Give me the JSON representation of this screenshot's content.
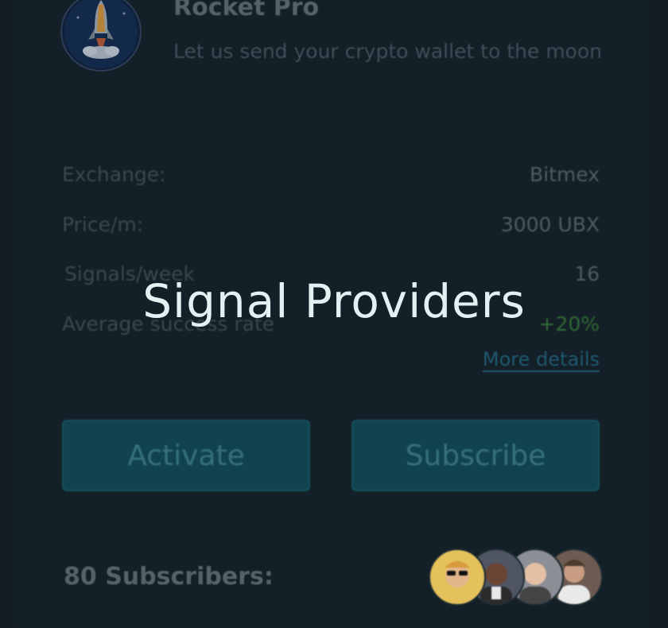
{
  "overlay": {
    "title": "Signal Providers"
  },
  "provider": {
    "name": "Rocket Pro",
    "tagline": "Let us send your crypto wallet to the moon",
    "logo_icon": "rocket-icon"
  },
  "details": [
    {
      "label": "Exchange:",
      "value": "Bitmex"
    },
    {
      "label": "Price/m:",
      "value": "3000 UBX"
    },
    {
      "label": "Signals/week",
      "value": "16"
    },
    {
      "label": "Average success rate",
      "value": "+20%"
    }
  ],
  "more_details_label": "More details",
  "buttons": {
    "activate": "Activate",
    "subscribe": "Subscribe"
  },
  "subscribers": {
    "label": "80 Subscribers:",
    "avatars": [
      "avatar-1",
      "avatar-2",
      "avatar-3",
      "avatar-4"
    ]
  },
  "colors": {
    "background": "#121e24",
    "button": "#11434f",
    "positive": "#2f6a34",
    "link": "#1f5870"
  }
}
